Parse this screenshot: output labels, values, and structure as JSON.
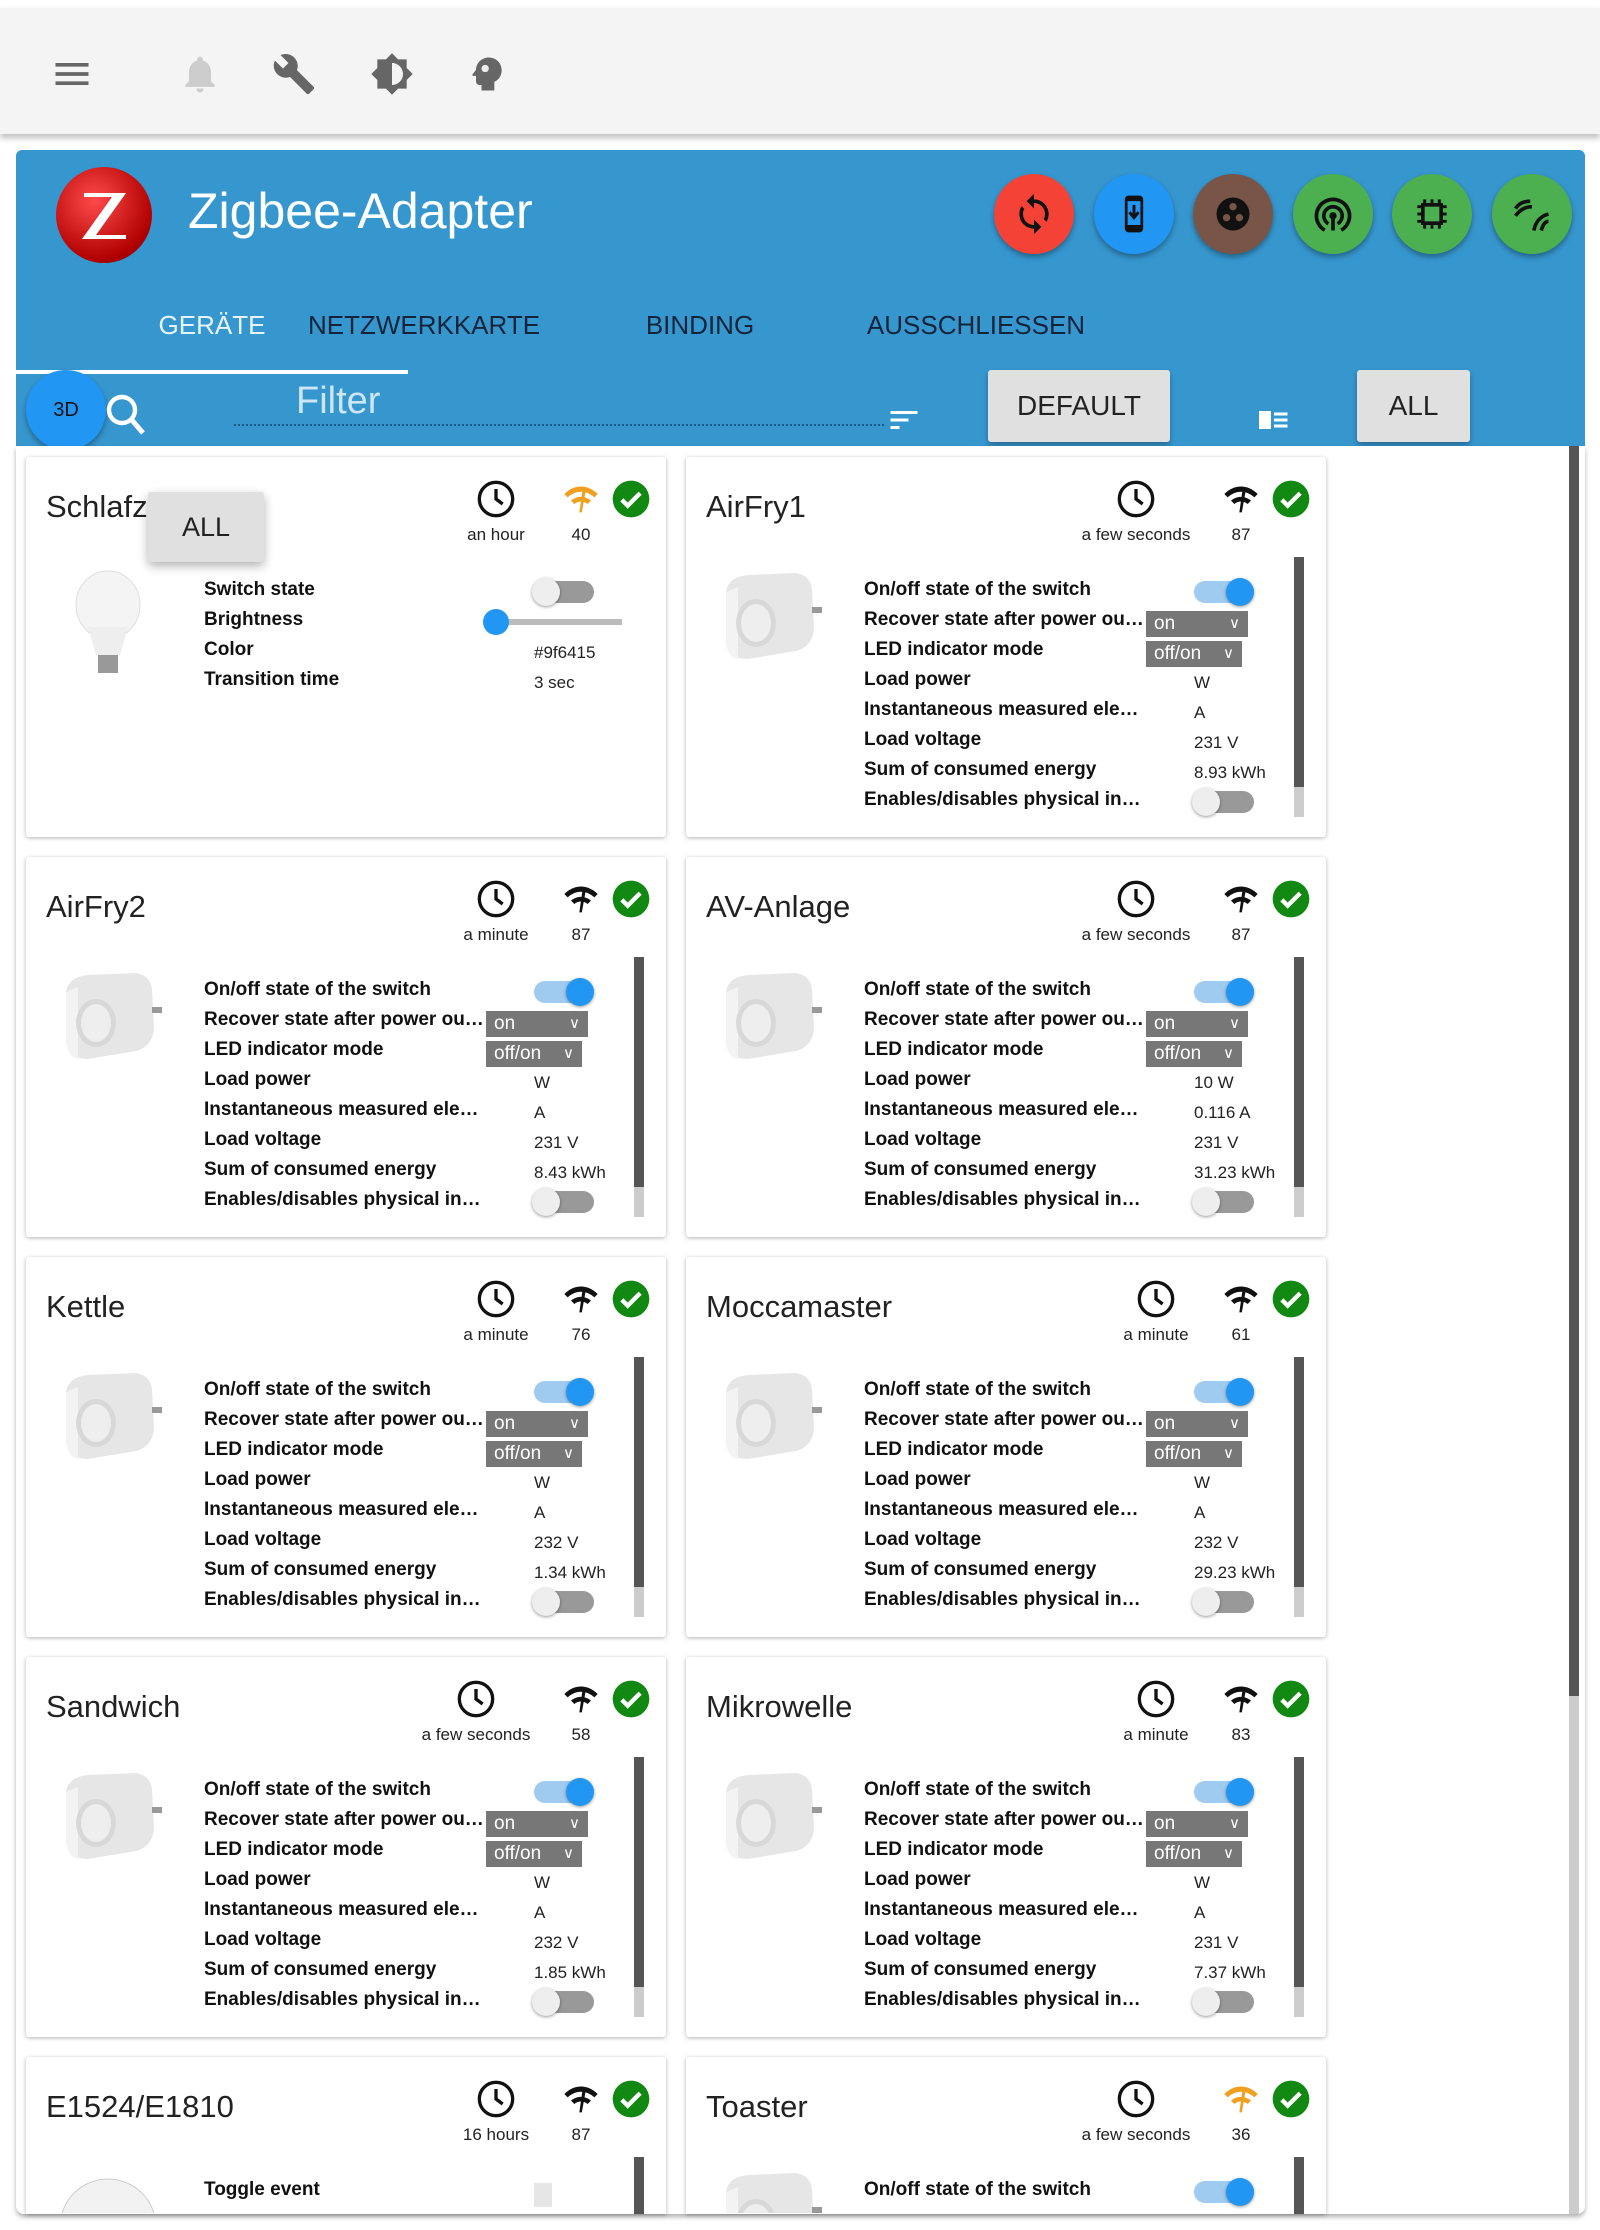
{
  "toolbar": {
    "icons": [
      "menu-icon",
      "bell-icon",
      "wrench-icon",
      "brightness-icon",
      "head-icon"
    ]
  },
  "header": {
    "title": "Zigbee-Adapter",
    "actions": [
      {
        "icon": "refresh-icon",
        "color": "#f44336"
      },
      {
        "icon": "phone-download-icon",
        "color": "#2196f3"
      },
      {
        "icon": "dots-icon",
        "color": "#795548"
      },
      {
        "icon": "pairing-icon",
        "color": "#4caf50"
      },
      {
        "icon": "chip-icon",
        "color": "#4caf50"
      },
      {
        "icon": "signal-icon",
        "color": "#4caf50"
      }
    ],
    "tabs": [
      "GERÄTE",
      "NETZWERKKARTE",
      "BINDING",
      "AUSSCHLIESSEN"
    ],
    "active_tab": 0
  },
  "filterbar": {
    "fab_label": "3D",
    "filter_placeholder": "Filter",
    "default_label": "DEFAULT",
    "all_label": "ALL"
  },
  "popup": {
    "label": "ALL"
  },
  "colors": {
    "accent": "#2196f3",
    "header": "#3697cf",
    "ok": "#118811",
    "link_good": "#111111",
    "link_weak": "#f0a020"
  },
  "devices": [
    {
      "name": "Schlafz",
      "time": "an hour",
      "link": "40",
      "link_weak": true,
      "type": "bulb",
      "rows": [
        {
          "label": "Switch state",
          "kind": "toggle",
          "on": false
        },
        {
          "label": "Brightness",
          "kind": "slider",
          "value": 0.07
        },
        {
          "label": "Color",
          "kind": "text",
          "value": "#9f6415"
        },
        {
          "label": "Transition time",
          "kind": "text",
          "value": "3 sec"
        }
      ]
    },
    {
      "name": "AirFry1",
      "time": "a few seconds",
      "link": "87",
      "type": "plug",
      "power": "W",
      "current": "A",
      "voltage": "231 V",
      "energy": "8.93 kWh"
    },
    {
      "name": "AirFry2",
      "time": "a minute",
      "link": "87",
      "type": "plug",
      "power": "W",
      "current": "A",
      "voltage": "231 V",
      "energy": "8.43 kWh"
    },
    {
      "name": "AV-Anlage",
      "time": "a few seconds",
      "link": "87",
      "type": "plug",
      "power": "10 W",
      "current": "0.116 A",
      "voltage": "231 V",
      "energy": "31.23 kWh"
    },
    {
      "name": "Kettle",
      "time": "a minute",
      "link": "76",
      "type": "plug",
      "power": "W",
      "current": "A",
      "voltage": "232 V",
      "energy": "1.34 kWh"
    },
    {
      "name": "Moccamaster",
      "time": "a minute",
      "link": "61",
      "type": "plug",
      "power": "W",
      "current": "A",
      "voltage": "232 V",
      "energy": "29.23 kWh"
    },
    {
      "name": "Sandwich",
      "time": "a few seconds",
      "link": "58",
      "type": "plug",
      "power": "W",
      "current": "A",
      "voltage": "232 V",
      "energy": "1.85 kWh"
    },
    {
      "name": "Mikrowelle",
      "time": "a minute",
      "link": "83",
      "type": "plug",
      "power": "W",
      "current": "A",
      "voltage": "231 V",
      "energy": "7.37 kWh"
    },
    {
      "name": "E1524/E1810",
      "time": "16 hours",
      "link": "87",
      "type": "remote",
      "rows": [
        {
          "label": "Toggle event",
          "kind": "box"
        }
      ]
    },
    {
      "name": "Toaster",
      "time": "a few seconds",
      "link": "36",
      "link_weak": true,
      "type": "plug",
      "partial": true
    }
  ],
  "plug_labels": {
    "onoff": "On/off state of the switch",
    "recover": "Recover state after power ou…",
    "recover_value": "on",
    "led": "LED indicator mode",
    "led_value": "off/on",
    "power": "Load power",
    "current": "Instantaneous measured ele…",
    "voltage": "Load voltage",
    "energy": "Sum of consumed energy",
    "physical": "Enables/disables physical in…"
  }
}
